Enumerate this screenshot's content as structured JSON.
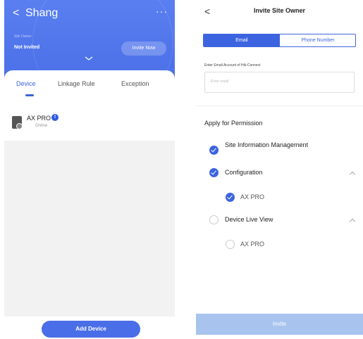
{
  "left": {
    "header": {
      "back_glyph": "<",
      "title": "Shang",
      "more_glyph": "···",
      "small_label": "Site Owner",
      "status": "Not Invited",
      "invite_button": "Invite Now"
    },
    "tabs": [
      {
        "label": "Device",
        "active": true
      },
      {
        "label": "Linkage Rule",
        "active": false
      },
      {
        "label": "Exception",
        "active": false
      }
    ],
    "device": {
      "name": "AX PRO",
      "info_glyph": "!",
      "status": "Online"
    },
    "add_device_button": "Add Device"
  },
  "right": {
    "back_glyph": "<",
    "title": "Invite Site Owner",
    "segments": {
      "email": "Email",
      "phone": "Phone Number"
    },
    "email_label": "Enter Email Account of Hik-Connect",
    "email_placeholder": "Enter email",
    "apply_title": "Apply for Permission",
    "permissions": {
      "site_info": {
        "label": "Site Information Management",
        "checked": true
      },
      "configuration": {
        "label": "Configuration",
        "checked": true
      },
      "configuration_ax": {
        "label": "AX PRO",
        "checked": true
      },
      "live_view": {
        "label": "Device Live View",
        "checked": false
      },
      "live_view_ax": {
        "label": "AX PRO",
        "checked": false
      }
    },
    "invite_button": "Invite"
  },
  "colors": {
    "primary": "#3c64e0",
    "header_blue": "#5a7ff0",
    "invite_disabled": "#a8c4ee"
  }
}
